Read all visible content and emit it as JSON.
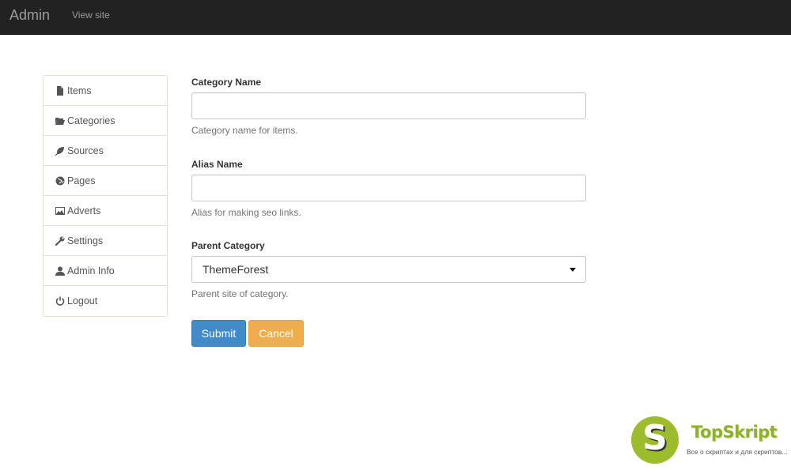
{
  "navbar": {
    "brand": "Admin",
    "view_site": "View site"
  },
  "sidebar": {
    "items": [
      {
        "label": "Items",
        "icon": "file-icon"
      },
      {
        "label": "Categories",
        "icon": "folder-open-icon"
      },
      {
        "label": "Sources",
        "icon": "leaf-icon"
      },
      {
        "label": "Pages",
        "icon": "globe-icon"
      },
      {
        "label": "Adverts",
        "icon": "picture-icon"
      },
      {
        "label": "Settings",
        "icon": "wrench-icon"
      },
      {
        "label": "Admin Info",
        "icon": "user-icon"
      },
      {
        "label": "Logout",
        "icon": "power-icon"
      }
    ]
  },
  "form": {
    "category_name": {
      "label": "Category Name",
      "value": "",
      "help": "Category name for items."
    },
    "alias_name": {
      "label": "Alias Name",
      "value": "",
      "help": "Alias for making seo links."
    },
    "parent_category": {
      "label": "Parent Category",
      "selected": "ThemeForest",
      "help": "Parent site of category."
    },
    "submit_label": "Submit",
    "cancel_label": "Cancel"
  },
  "watermark": {
    "logo_letter": "S",
    "title": "TopSkript",
    "subtitle": "Все о скриптах и для скриптов..."
  },
  "colors": {
    "navbar_bg": "#222222",
    "primary": "#428bca",
    "warning": "#f0ad4e",
    "watermark_green": "#9cbc2e"
  }
}
